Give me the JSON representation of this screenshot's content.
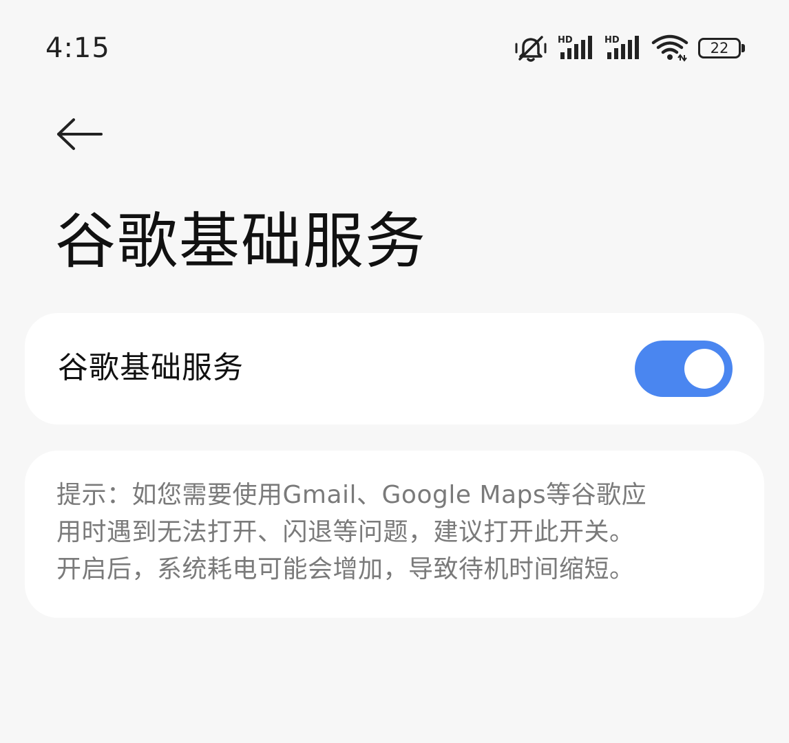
{
  "status_bar": {
    "time": "4:15",
    "icons": [
      "vibrate-silent-icon",
      "hd-signal-icon",
      "hd-signal-icon",
      "wifi-icon",
      "battery-icon"
    ],
    "signal_label": "HD",
    "battery_level": "22"
  },
  "header": {
    "back_icon": "back-arrow-icon",
    "title": "谷歌基础服务"
  },
  "settings": {
    "google_services": {
      "label": "谷歌基础服务",
      "enabled": true,
      "accent_color": "#4a86f0"
    }
  },
  "hint": {
    "lines": [
      "提示：如您需要使用Gmail、Google Maps等谷歌应",
      "用时遇到无法打开、闪退等问题，建议打开此开关。",
      "开启后，系统耗电可能会增加，导致待机时间缩短。"
    ]
  }
}
